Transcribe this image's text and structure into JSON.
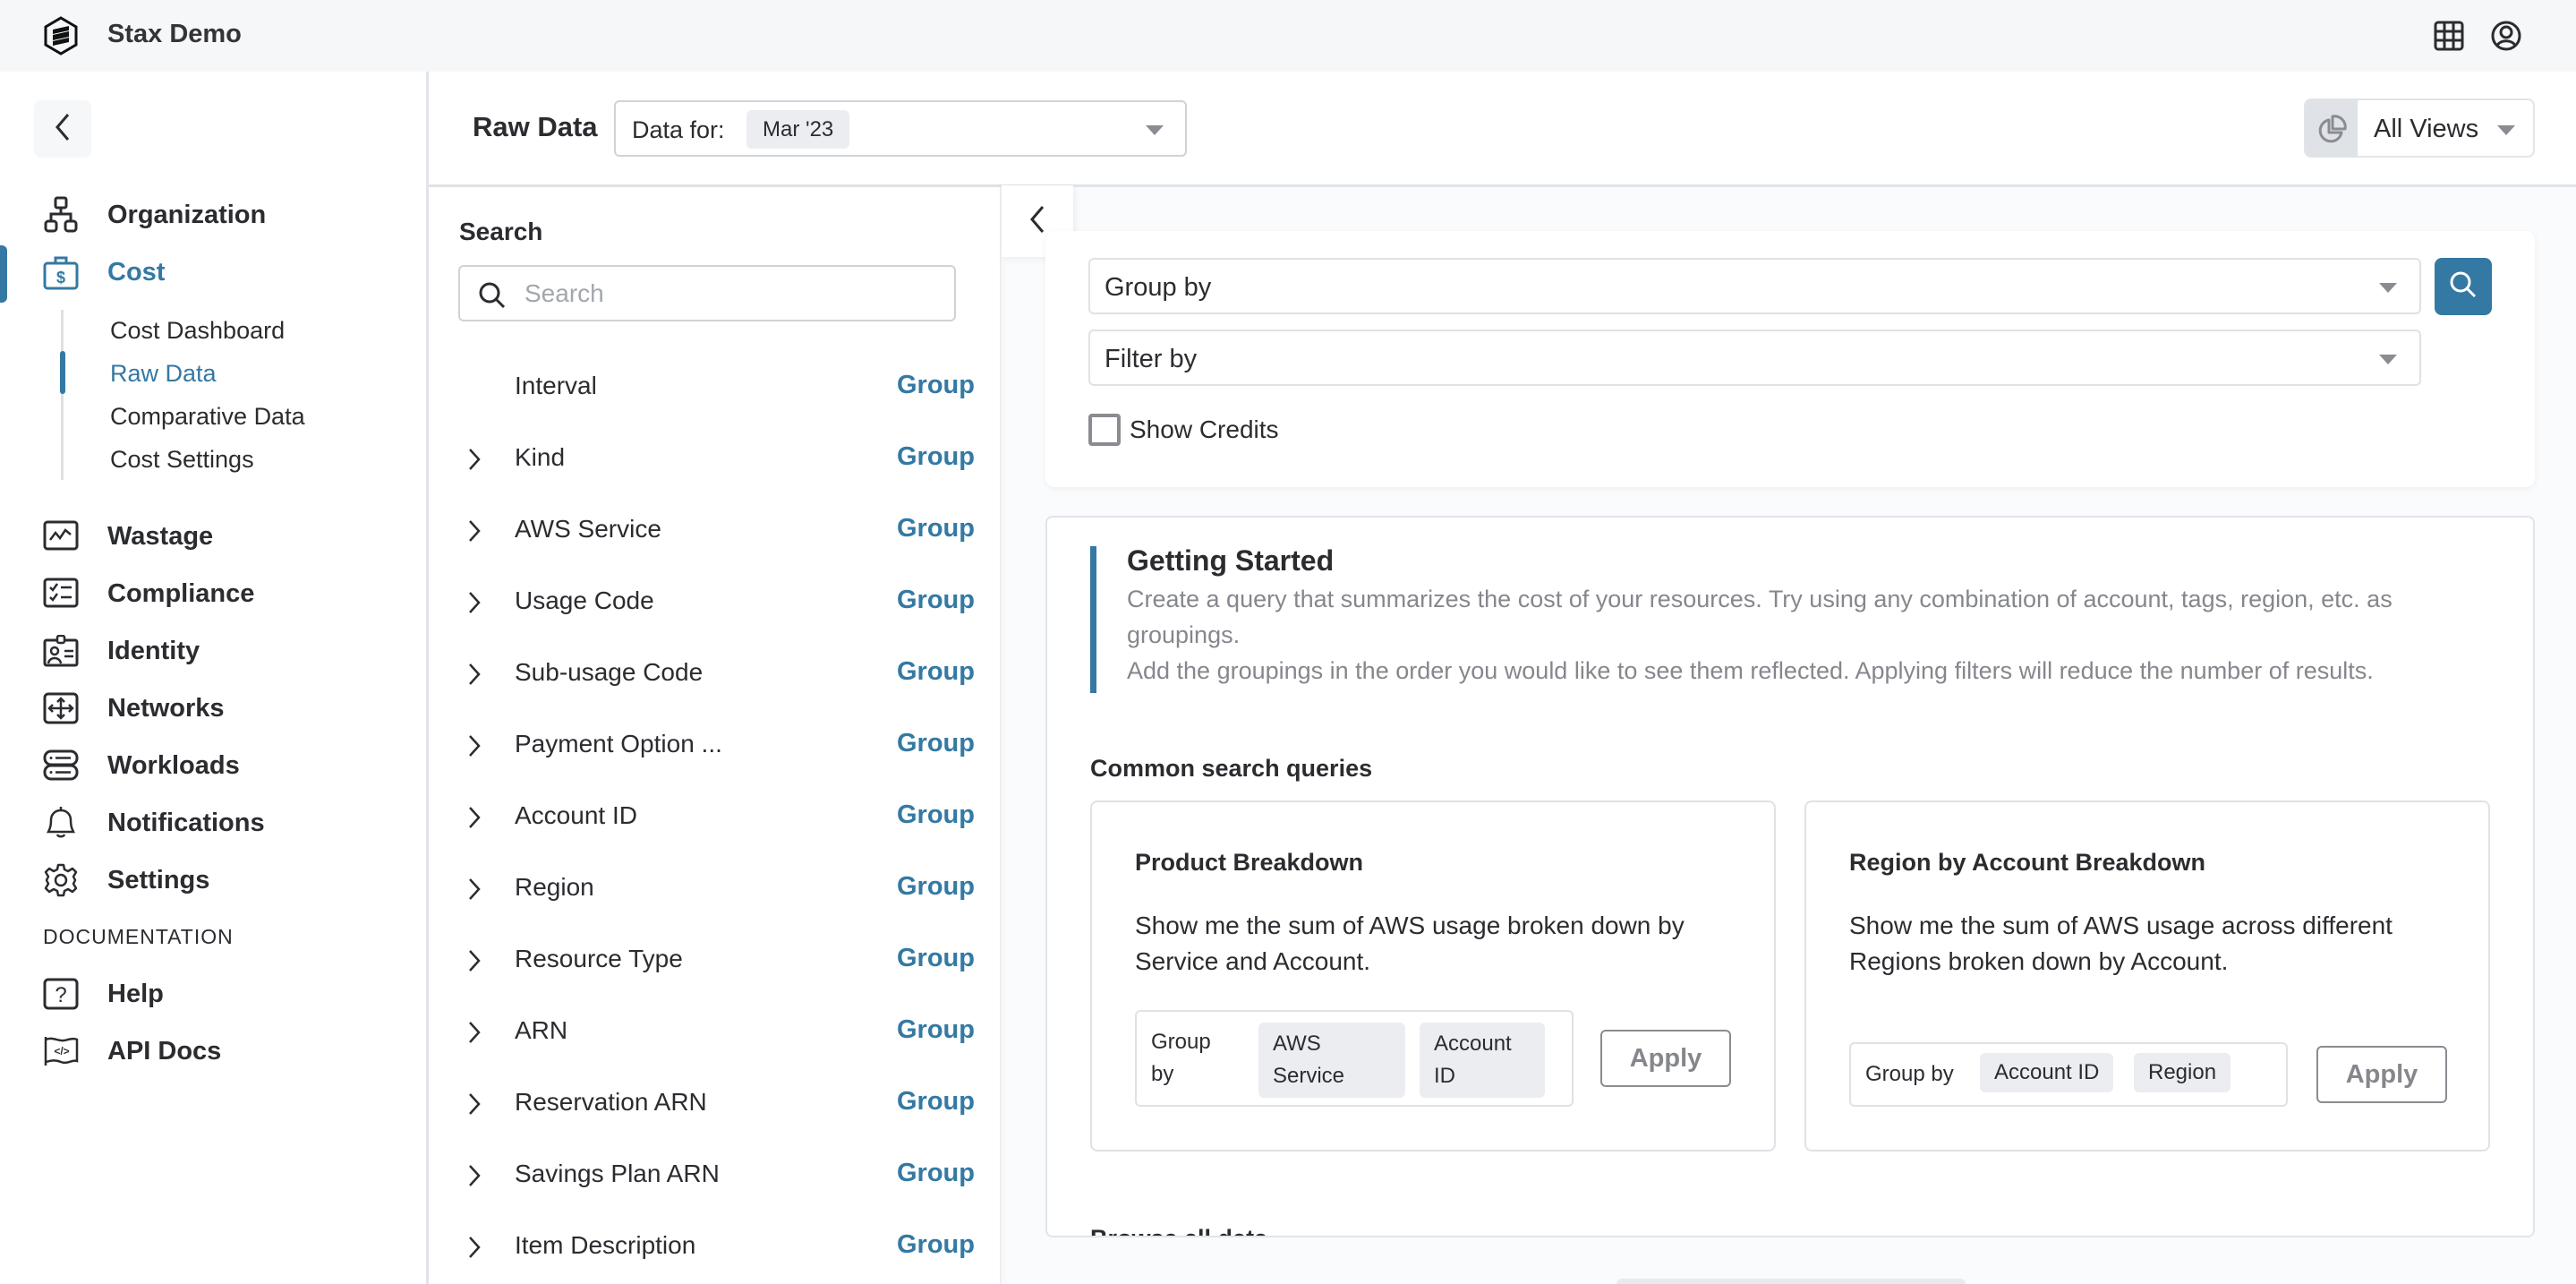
{
  "app": {
    "name": "Stax Demo",
    "icons": {
      "logo": "stax-hexagon-logo",
      "grid": "app-grid-icon",
      "profile": "user-circle-icon"
    }
  },
  "sidebar": {
    "collapse_icon": "chevron-left-icon",
    "items": [
      {
        "label": "Organization",
        "icon": "org-chart-icon",
        "active": false
      },
      {
        "label": "Cost",
        "icon": "briefcase-dollar-icon",
        "active": true
      },
      {
        "label": "Wastage",
        "icon": "activity-chart-icon",
        "active": false
      },
      {
        "label": "Compliance",
        "icon": "checklist-icon",
        "active": false
      },
      {
        "label": "Identity",
        "icon": "id-badge-icon",
        "active": false
      },
      {
        "label": "Networks",
        "icon": "move-arrows-icon",
        "active": false
      },
      {
        "label": "Workloads",
        "icon": "server-stack-icon",
        "active": false
      },
      {
        "label": "Notifications",
        "icon": "bell-icon",
        "active": false
      },
      {
        "label": "Settings",
        "icon": "gear-icon",
        "active": false
      }
    ],
    "cost_subitems": [
      {
        "label": "Cost Dashboard",
        "active": false
      },
      {
        "label": "Raw Data",
        "active": true
      },
      {
        "label": "Comparative Data",
        "active": false
      },
      {
        "label": "Cost Settings",
        "active": false
      }
    ],
    "documentation_label": "DOCUMENTATION",
    "doc_items": [
      {
        "label": "Help",
        "icon": "help-question-icon"
      },
      {
        "label": "API Docs",
        "icon": "code-flag-icon"
      }
    ]
  },
  "page": {
    "title": "Raw Data",
    "data_for_label": "Data for:",
    "data_for_value": "Mar '23",
    "views_label": "All Views",
    "views_icon": "pie-chart-icon"
  },
  "search_panel": {
    "heading": "Search",
    "search_placeholder": "Search",
    "search_value": "",
    "collapse_icon": "chevron-left-icon",
    "fields": [
      {
        "label": "Interval",
        "expandable": false,
        "action": "Group"
      },
      {
        "label": "Kind",
        "expandable": true,
        "action": "Group"
      },
      {
        "label": "AWS Service",
        "expandable": true,
        "action": "Group"
      },
      {
        "label": "Usage Code",
        "expandable": true,
        "action": "Group"
      },
      {
        "label": "Sub-usage Code",
        "expandable": true,
        "action": "Group"
      },
      {
        "label": "Payment Option ...",
        "expandable": true,
        "action": "Group"
      },
      {
        "label": "Account ID",
        "expandable": true,
        "action": "Group"
      },
      {
        "label": "Region",
        "expandable": true,
        "action": "Group"
      },
      {
        "label": "Resource Type",
        "expandable": true,
        "action": "Group"
      },
      {
        "label": "ARN",
        "expandable": true,
        "action": "Group"
      },
      {
        "label": "Reservation ARN",
        "expandable": true,
        "action": "Group"
      },
      {
        "label": "Savings Plan ARN",
        "expandable": true,
        "action": "Group"
      },
      {
        "label": "Item Description",
        "expandable": true,
        "action": "Group"
      }
    ]
  },
  "query": {
    "group_by_placeholder": "Group by",
    "filter_by_placeholder": "Filter by",
    "show_credits_label": "Show Credits",
    "show_credits_checked": false,
    "search_icon": "search-icon"
  },
  "getting_started": {
    "title": "Getting Started",
    "line1": "Create a query that summarizes the cost of your resources. Try using any combination of account, tags, region, etc. as groupings.",
    "line2": "Add the groupings in the order you would like to see them reflected. Applying filters will reduce the number of results.",
    "common_title": "Common search queries",
    "queries": [
      {
        "title": "Product Breakdown",
        "description": "Show me the sum of AWS usage broken down by Service and Account.",
        "group_label": "Group by",
        "chips": [
          "AWS Service",
          "Account ID"
        ],
        "apply_label": "Apply"
      },
      {
        "title": "Region by Account Breakdown",
        "description": "Show me the sum of AWS usage across different Regions broken down by Account.",
        "group_label": "Group by",
        "chips": [
          "Account ID",
          "Region"
        ],
        "apply_label": "Apply"
      }
    ],
    "browse_title": "Browse all data"
  },
  "colors": {
    "accent": "#3479a3",
    "text": "#2b2c30",
    "muted": "#85878d",
    "header_bg": "#f6f7f9",
    "border": "#dfe2e6"
  }
}
